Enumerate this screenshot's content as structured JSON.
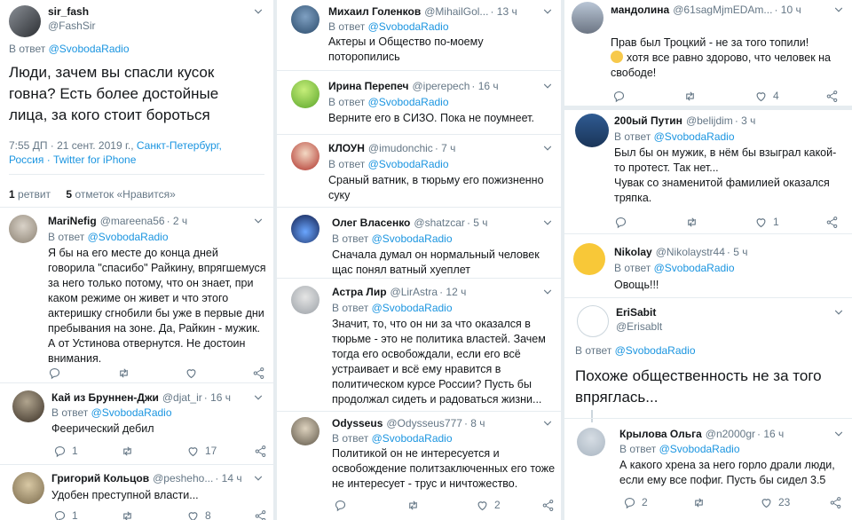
{
  "col1": {
    "main": {
      "name": "sir_fash",
      "handle": "@FashSir",
      "reply_prefix": "В ответ",
      "reply_to": "@SvobodaRadio",
      "text": "Люди, зачем вы спасли кусок говна? Есть более достойные лица, за кого стоит бороться",
      "time": "7:55 ДП · 21 сент. 2019 г.,",
      "location": "Санкт-Петербург, Россия",
      "source": "· Twitter for iPhone",
      "retweets_count": "1",
      "retweets_label": "ретвит",
      "likes_count": "5",
      "likes_label": "отметок «Нравится»"
    },
    "r1": {
      "name": "MariNefig",
      "handle": "@mareena56",
      "time": "· 2 ч",
      "reply_prefix": "В ответ",
      "reply_to": "@SvobodaRadio",
      "text": "Я бы на его месте до конца дней говорила \"спасибо\" Райкину, впрягшемуся за него только потому, что он знает, при каком режиме он живет и что этого актеришку сгнобили бы уже в первые дни пребывания на зоне. Да, Райкин - мужик. А от Устинова отвернутся. Не достоин внимания."
    },
    "r2": {
      "name": "Кай из Бруннен-Джи",
      "handle": "@djat_ir",
      "time": "· 16 ч",
      "reply_prefix": "В ответ",
      "reply_to": "@SvobodaRadio",
      "text": "Феерический дебил",
      "replies": "1",
      "likes": "17"
    },
    "r3": {
      "name": "Григорий Кольцов",
      "handle": "@pesheho...",
      "time": "· 14 ч",
      "text": "Удобен преступной власти...",
      "replies": "1",
      "likes": "8"
    }
  },
  "col2": {
    "t1": {
      "name": "Михаил Голенков",
      "handle": "@MihailGol...",
      "time": "· 13 ч",
      "reply_prefix": "В ответ",
      "reply_to": "@SvobodaRadio",
      "text": "Актеры и Общество по-моему поторопились"
    },
    "t2": {
      "name": "Ирина Перепеч",
      "handle": "@iperepech",
      "time": "· 16 ч",
      "reply_prefix": "В ответ",
      "reply_to": "@SvobodaRadio",
      "text": "Верните его в СИЗО. Пока не поумнеет."
    },
    "t3": {
      "name": "КЛОУН",
      "handle": "@imudonchic",
      "time": "· 7 ч",
      "reply_prefix": "В ответ",
      "reply_to": "@SvobodaRadio",
      "text": "Сраный ватник, в тюрьму его пожизненно суку"
    },
    "t4": {
      "name": "Олег Власенко",
      "handle": "@shatzcar",
      "time": "· 5 ч",
      "reply_prefix": "В ответ",
      "reply_to": "@SvobodaRadio",
      "text": "Сначала думал он нормальный человек щас понял ватный хуеплет"
    },
    "t5": {
      "name": "Астра Лир",
      "handle": "@LirAstra",
      "time": "· 12 ч",
      "reply_prefix": "В ответ",
      "reply_to": "@SvobodaRadio",
      "text": "Значит, то, что он ни за что оказался в тюрьме - это не политика властей. Зачем тогда его освобождали, если его всё устраивает и всё ему нравится в политическом курсе России? Пусть бы продолжал сидеть и радоваться жизни..."
    },
    "t6": {
      "name": "Odysseus",
      "handle": "@Odysseus777",
      "time": "· 8 ч",
      "reply_prefix": "В ответ",
      "reply_to": "@SvobodaRadio",
      "text": "Политикой он не интересуется и освобождение политзаключенных его тоже не интересует - трус и ничтожество.",
      "likes": "2"
    }
  },
  "col3": {
    "t1": {
      "name": "мандолина",
      "handle": "@61sagMjmEDAm...",
      "time": "· 10 ч",
      "text_line1": "Прав был Троцкий - не за того топили!",
      "text_rest": "хотя все равно здорово, что человек на свободе!",
      "likes": "4"
    },
    "t2": {
      "name": "200ый Путин",
      "handle": "@belijdim",
      "time": "· 3 ч",
      "reply_prefix": "В ответ",
      "reply_to": "@SvobodaRadio",
      "text1": "Был бы он мужик, в нём бы взыграл какой-то протест. Так нет...",
      "text2": "Чувак со знаменитой фамилией оказался тряпка.",
      "likes": "1"
    },
    "t3": {
      "name": "Nikolay",
      "handle": "@Nikolaystr44",
      "time": "· 5 ч",
      "reply_prefix": "В ответ",
      "reply_to": "@SvobodaRadio",
      "text": "Овощь!!!"
    },
    "t4": {
      "name": "EriSabit",
      "handle": "@Erisablt",
      "reply_prefix": "В ответ",
      "reply_to": "@SvobodaRadio",
      "text": "Похоже общественность не за того впряглась..."
    },
    "t5": {
      "name": "Крылова Ольга",
      "handle": "@n2000gr",
      "time": "· 16 ч",
      "reply_prefix": "В ответ",
      "reply_to": "@SvobodaRadio",
      "text": "А какого хрена за него горло драли люди, если ему все пофиг. Пусть бы сидел 3.5",
      "replies": "2",
      "likes": "23"
    }
  },
  "colors": {
    "link": "#1b95e0",
    "muted": "#657786",
    "text": "#14171a",
    "border": "#e6ecf0"
  },
  "icons": [
    "reply-icon",
    "retweet-icon",
    "like-icon",
    "share-icon",
    "chevron-down-icon"
  ]
}
